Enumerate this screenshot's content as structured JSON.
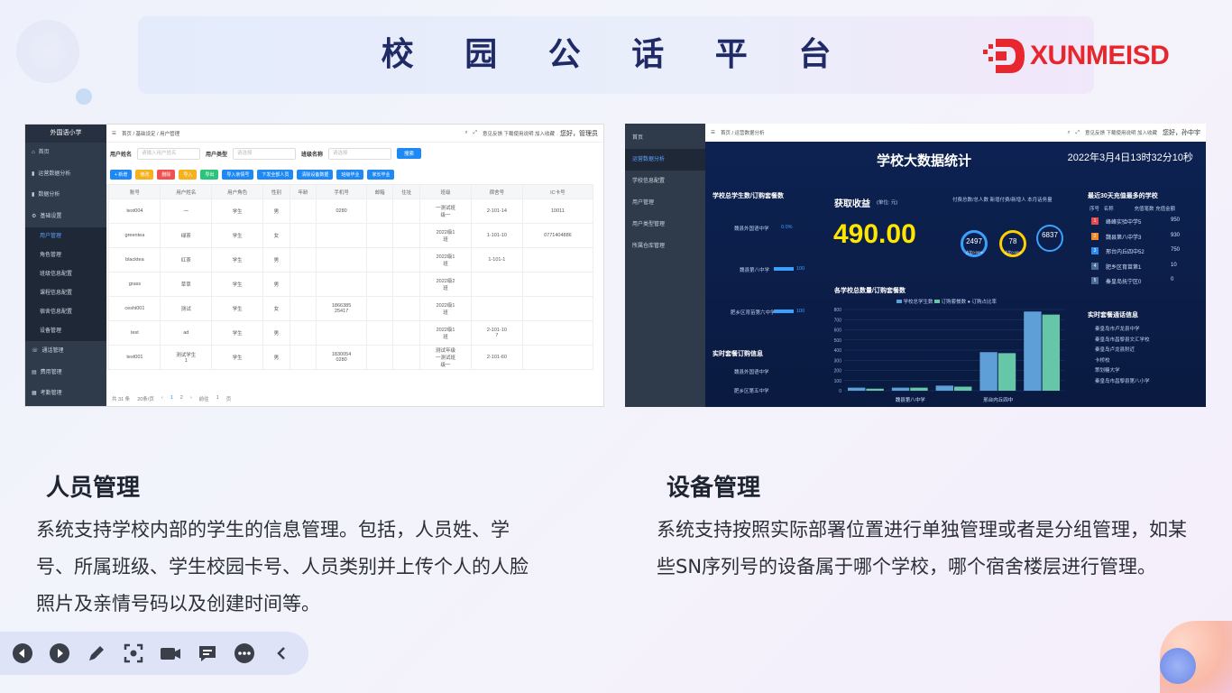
{
  "header": {
    "title": "校 园 公 话 平 台",
    "logo_text": "XUNMEISD",
    "brand_color": "#e8262d"
  },
  "screenshot1": {
    "sidebar": {
      "school": "外国语小学",
      "items": [
        "首页",
        "运营数据分析",
        "数据分析",
        "基础设置"
      ],
      "subitems": [
        "用户管理",
        "角色管理",
        "班级信息配置",
        "课程信息配置",
        "宿舍信息配置",
        "设备管理"
      ],
      "items_bottom": [
        "通话管理",
        "费用管理",
        "考勤管理"
      ]
    },
    "topbar": {
      "breadcrumb": "首页 / 基础设定 / 用户管理",
      "links": "意见反馈  下载使用说明  加入收藏",
      "greeting": "您好，管理员"
    },
    "filter": {
      "name_label": "用户姓名",
      "name_placeholder": "请输入用户姓名",
      "type_label": "用户类型",
      "type_placeholder": "请选择",
      "class_label": "班级名称",
      "class_placeholder": "请选择",
      "search": "搜索"
    },
    "actions": [
      {
        "label": "+ 新增",
        "color": "#1e88f5"
      },
      {
        "label": "修改",
        "color": "#f5b21e"
      },
      {
        "label": "删除",
        "color": "#f05050"
      },
      {
        "label": "导入",
        "color": "#f5b21e"
      },
      {
        "label": "导出",
        "color": "#2bc47a"
      },
      {
        "label": "导入亲情号",
        "color": "#1e88f5"
      },
      {
        "label": "下发全部人员",
        "color": "#1e88f5"
      },
      {
        "label": "清除设备数据",
        "color": "#1e88f5"
      },
      {
        "label": "班级毕业",
        "color": "#1e88f5"
      },
      {
        "label": "家长毕业",
        "color": "#1e88f5"
      }
    ],
    "table": {
      "headers": [
        "",
        "账号",
        "用户姓名",
        "用户角色",
        "性别",
        "年龄",
        "手机号",
        "邮箱",
        "住址",
        "班级",
        "宿舍号",
        "IC卡号"
      ],
      "rows": [
        [
          "",
          "text004",
          "一",
          "学生",
          "男",
          "",
          "0280",
          "",
          "",
          "一测试班\n级一",
          "2-101-14",
          "10011"
        ],
        [
          "",
          "greentea",
          "绿茶",
          "学生",
          "女",
          "",
          "",
          "",
          "",
          "2022级1\n班",
          "1-101-10",
          "0771404886"
        ],
        [
          "",
          "blacktea",
          "红茶",
          "学生",
          "男",
          "",
          "",
          "",
          "",
          "2022级1\n班",
          "1-101-1",
          ""
        ],
        [
          "",
          "grass",
          "草草",
          "学生",
          "男",
          "",
          "",
          "",
          "",
          "2022级2\n班",
          "",
          ""
        ],
        [
          "",
          "ceshi001",
          "测试",
          "学生",
          "女",
          "",
          "1866385\n25417",
          "",
          "",
          "2022级1\n班",
          "",
          ""
        ],
        [
          "",
          "test",
          "ad",
          "学生",
          "男",
          "",
          "",
          "",
          "",
          "2022级1\n班",
          "2-101-10\n7",
          ""
        ],
        [
          "",
          "text001",
          "测试学生\n1",
          "学生",
          "男",
          "",
          "1830054\n0280",
          "",
          "",
          "测试年级\n一测试班\n级一",
          "2-101-60",
          ""
        ]
      ]
    },
    "pager": {
      "total": "共 31 条",
      "size": "20条/页",
      "page1": "1",
      "page2": "2",
      "goto": "前往",
      "goto_value": "1",
      "page_unit": "页"
    }
  },
  "screenshot2": {
    "sidebar": [
      "首页",
      "运营数据分析",
      "学校信息配置",
      "用户管理",
      "用户类型管理",
      "所属仓库管理"
    ],
    "topbar": {
      "breadcrumb": "首页 / 运营数据分析",
      "links": "意见反馈  下载使用说明  加入收藏",
      "greeting": "您好，孙中宇"
    },
    "dashboard": {
      "title": "学校大数据统计",
      "datetime": "2022年3月4日13时32分10秒",
      "left_panel_title": "学校总学生数/订购套餐数",
      "left_items": [
        "魏县第八中学",
        "肥乡区育苗第六中学"
      ],
      "left_item_top": "魏县外国语中学",
      "left_item_top_pct": "0.0%",
      "left_value": "100",
      "income_label": "获取收益",
      "income_unit": "(单位: 元)",
      "income_value": "490.00",
      "stat_header": "付费总数/总人数 新增付费/新增人 本月话务量",
      "ring1": "2497",
      "ring1_sub": "占比0.00%",
      "ring2": "78",
      "ring2_sub": "占比0.00%",
      "ring3": "6837",
      "chart_title": "各学校总数量/订购套餐数",
      "legend": [
        "学校总学生数",
        "订购套餐数",
        "订购占比率"
      ],
      "live_orders_title": "实时套餐订购信息",
      "live_orders": [
        "魏县外国语中学",
        "肥乡区第五中学"
      ],
      "rank_title": "最近30天充值最多的学校",
      "rank_headers": [
        "序号",
        "名称",
        "充值笔数",
        "充值金额"
      ],
      "rank": [
        {
          "no": "1",
          "name": "峰峰实验中学5",
          "value": "950",
          "color": "#e64a4a"
        },
        {
          "no": "2",
          "name": "魏县第八中学3",
          "value": "930",
          "color": "#f08a2e"
        },
        {
          "no": "3",
          "name": "邢台内丘四中52",
          "value": "750",
          "color": "#2e8af0"
        },
        {
          "no": "4",
          "name": "肥乡区育苗第1",
          "value": "10",
          "color": "#4a6a9a"
        },
        {
          "no": "5",
          "name": "秦皇岛抚宁区0",
          "value": "0",
          "color": "#4a6a9a"
        }
      ],
      "live_call_title": "实时套餐通话信息",
      "live_calls": [
        "秦皇岛市卢龙县中学",
        "秦皇岛市昌黎县文汇学校",
        "秦皇岛卢龙县附近",
        "卡桥校",
        "策划糖大学",
        "秦皇岛市昌黎县第八小学"
      ],
      "x_labels": [
        "魏县第八中学",
        "邢台内丘四中"
      ],
      "y_ticks": [
        "800",
        "700",
        "600",
        "500",
        "400",
        "300",
        "200",
        "100",
        "0"
      ]
    }
  },
  "chart_data": {
    "type": "bar",
    "title": "各学校总数量/订购套餐数",
    "categories": [
      "",
      "魏县第八中学",
      "",
      "邢台内丘四中",
      ""
    ],
    "series": [
      {
        "name": "学校总学生数",
        "values": [
          30,
          30,
          50,
          380,
          780
        ]
      },
      {
        "name": "订购套餐数",
        "values": [
          20,
          30,
          40,
          370,
          750
        ]
      }
    ],
    "ylim": [
      0,
      800
    ]
  },
  "captions": {
    "left_title": "人员管理",
    "left_text": "系统支持学校内部的学生的信息管理。包括，人员姓、学号、所属班级、学生校园卡号、人员类别并上传个人的人脸照片及亲情号码以及创建时间等。",
    "right_title": "设备管理",
    "right_text": "系统支持按照实际部署位置进行单独管理或者是分组管理，如某些SN序列号的设备属于哪个学校，哪个宿舍楼层进行管理。"
  },
  "toolbar": {
    "icons": [
      "prev-icon",
      "next-icon",
      "pen-icon",
      "screenshot-icon",
      "camera-icon",
      "comment-icon",
      "more-icon",
      "collapse-icon"
    ]
  }
}
